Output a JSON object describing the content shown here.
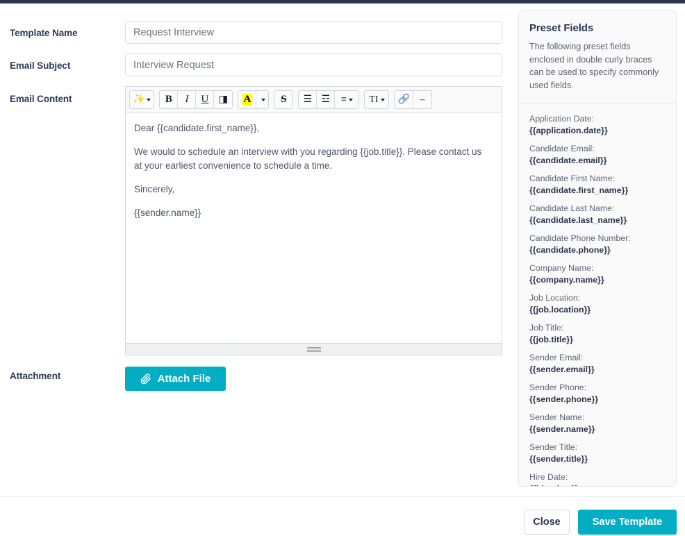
{
  "form": {
    "template_name": {
      "label": "Template Name",
      "value": "Request Interview",
      "placeholder": "Template Name"
    },
    "email_subject": {
      "label": "Email Subject",
      "value": "Interview Request",
      "placeholder": "Email Subject"
    },
    "email_content": {
      "label": "Email Content",
      "paragraphs": [
        "Dear {{candidate.first_name}},",
        "We would to schedule an interview with you regarding {{job.title}}.  Please contact us at your earliest convenience to schedule a time.",
        "Sincerely,",
        "{{sender.name}}"
      ]
    },
    "attachment": {
      "label": "Attachment",
      "button_label": "Attach File",
      "button_icon": "paperclip-icon"
    }
  },
  "toolbar": {
    "groups": [
      {
        "name": "styles",
        "buttons": [
          {
            "name": "magic-wand-styles-icon",
            "glyph": "✨",
            "has_caret": true,
            "wide": true
          }
        ]
      },
      {
        "name": "text-format",
        "buttons": [
          {
            "name": "bold-icon",
            "glyph": "B",
            "has_caret": false
          },
          {
            "name": "italic-icon",
            "glyph": "I",
            "has_caret": false
          },
          {
            "name": "underline-icon",
            "glyph": "U",
            "has_caret": false
          },
          {
            "name": "remove-format-icon",
            "glyph": "◨",
            "has_caret": false
          }
        ]
      },
      {
        "name": "color",
        "buttons": [
          {
            "name": "text-highlight-color-icon",
            "glyph": "A",
            "has_caret": false,
            "highlight": true
          },
          {
            "name": "color-dropdown-caret-icon",
            "glyph": "",
            "has_caret": true,
            "narrow": true
          }
        ]
      },
      {
        "name": "strikethrough",
        "buttons": [
          {
            "name": "strikethrough-icon",
            "glyph": "S",
            "has_caret": false
          }
        ]
      },
      {
        "name": "lists-align",
        "buttons": [
          {
            "name": "unordered-list-icon",
            "glyph": "☰",
            "has_caret": false
          },
          {
            "name": "ordered-list-icon",
            "glyph": "☲",
            "has_caret": false
          },
          {
            "name": "align-icon",
            "glyph": "≡",
            "has_caret": true,
            "wide": true
          }
        ]
      },
      {
        "name": "paragraph-format",
        "buttons": [
          {
            "name": "text-size-icon",
            "glyph": "TI",
            "has_caret": true,
            "wide": true
          }
        ]
      },
      {
        "name": "insert",
        "buttons": [
          {
            "name": "insert-link-icon",
            "glyph": "🔗",
            "has_caret": false
          },
          {
            "name": "horizontal-rule-icon",
            "glyph": "–",
            "has_caret": false
          }
        ]
      }
    ]
  },
  "preset_fields": {
    "title": "Preset Fields",
    "description": "The following preset fields enclosed in double curly braces can be used to specify commonly used fields.",
    "items": [
      {
        "label": "Application Date:",
        "token": "{{application.date}}"
      },
      {
        "label": "Candidate Email:",
        "token": "{{candidate.email}}"
      },
      {
        "label": "Candidate First Name:",
        "token": "{{candidate.first_name}}"
      },
      {
        "label": "Candidate Last Name:",
        "token": "{{candidate.last_name}}"
      },
      {
        "label": "Candidate Phone Number:",
        "token": "{{candidate.phone}}"
      },
      {
        "label": "Company Name:",
        "token": "{{company.name}}"
      },
      {
        "label": "Job Location:",
        "token": "{{job.location}}"
      },
      {
        "label": "Job Title:",
        "token": "{{job.title}}"
      },
      {
        "label": "Sender Email:",
        "token": "{{sender.email}}"
      },
      {
        "label": "Sender Phone:",
        "token": "{{sender.phone}}"
      },
      {
        "label": "Sender Name:",
        "token": "{{sender.name}}"
      },
      {
        "label": "Sender Title:",
        "token": "{{sender.title}}"
      },
      {
        "label": "Hire Date:",
        "token": "{{hire.date}}"
      }
    ]
  },
  "footer": {
    "close_label": "Close",
    "save_label": "Save Template"
  },
  "colors": {
    "accent_teal": "#03aec4",
    "label_navy": "#2d3a58",
    "topbar_navy": "#2e3650",
    "highlight_yellow": "#ffff00"
  }
}
